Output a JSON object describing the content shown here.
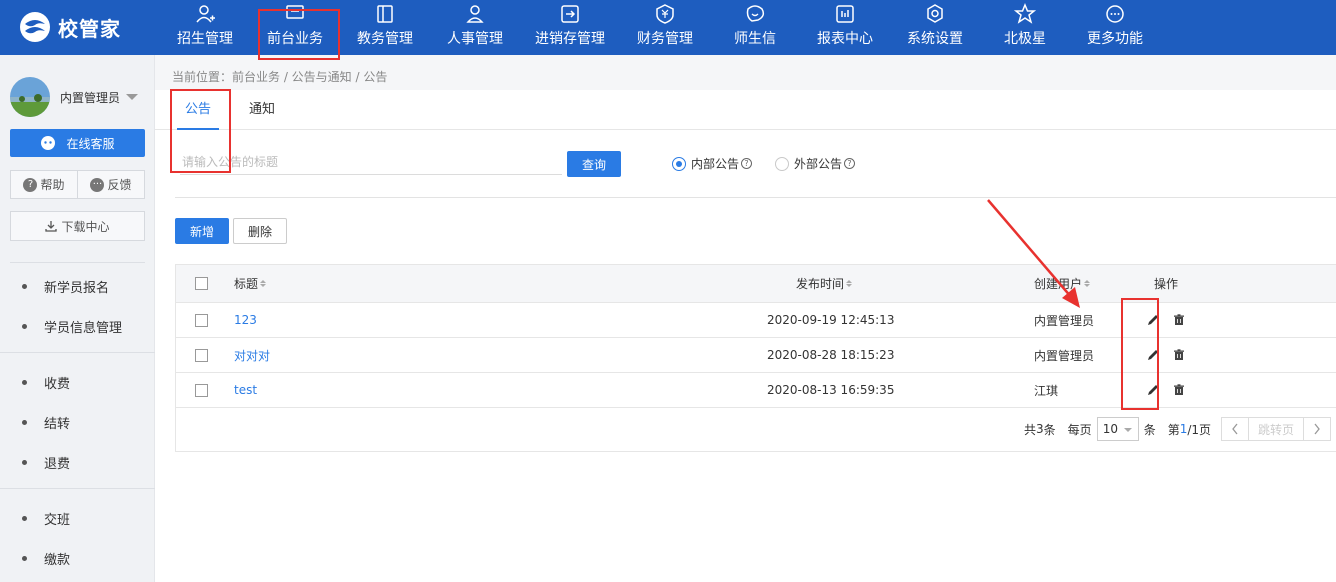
{
  "brand": {
    "name": "校管家"
  },
  "nav": [
    {
      "label": "招生管理",
      "icon": "person-add-icon"
    },
    {
      "label": "前台业务",
      "icon": "monitor-icon"
    },
    {
      "label": "教务管理",
      "icon": "book-icon"
    },
    {
      "label": "人事管理",
      "icon": "person-icon"
    },
    {
      "label": "进销存管理",
      "icon": "inventory-icon"
    },
    {
      "label": "财务管理",
      "icon": "yen-icon"
    },
    {
      "label": "师生信",
      "icon": "chat-icon"
    },
    {
      "label": "报表中心",
      "icon": "report-icon"
    },
    {
      "label": "系统设置",
      "icon": "gear-icon"
    },
    {
      "label": "北极星",
      "icon": "star-icon"
    },
    {
      "label": "更多功能",
      "icon": "more-icon"
    }
  ],
  "sidebar": {
    "user_name": "内置管理员",
    "service_label": "在线客服",
    "help_label": "帮助",
    "feedback_label": "反馈",
    "download_label": "下载中心",
    "groups": [
      [
        "新学员报名",
        "学员信息管理"
      ],
      [
        "收费",
        "结转",
        "退费"
      ],
      [
        "交班",
        "缴款"
      ]
    ]
  },
  "breadcrumb": "当前位置：前台业务 / 公告与通知 / 公告",
  "tabs": [
    "公告",
    "通知"
  ],
  "search": {
    "placeholder": "请输入公告的标题",
    "button": "查询"
  },
  "radios": [
    {
      "label": "内部公告",
      "checked": true
    },
    {
      "label": "外部公告",
      "checked": false
    }
  ],
  "actions": {
    "add": "新增",
    "delete": "删除"
  },
  "table": {
    "headers": {
      "title": "标题",
      "time": "发布时间",
      "creator": "创建用户",
      "ops": "操作"
    },
    "rows": [
      {
        "title": "123",
        "time": "2020-09-19 12:45:13",
        "creator": "内置管理员"
      },
      {
        "title": "对对对",
        "time": "2020-08-28 18:15:23",
        "creator": "内置管理员"
      },
      {
        "title": "test",
        "time": "2020-08-13 16:59:35",
        "creator": "江琪"
      }
    ]
  },
  "pager": {
    "total_prefix": "共",
    "total": "3",
    "total_suffix": "条",
    "per_page_label": "每页",
    "per_page": "10",
    "per_page_suffix": "条",
    "page_prefix": "第",
    "page_current": "1",
    "page_rest": "/1页",
    "jump": "跳转页"
  },
  "colors": {
    "header_bg": "#1e5dbf",
    "accent": "#2a7be4",
    "annotation": "#e8322f"
  }
}
